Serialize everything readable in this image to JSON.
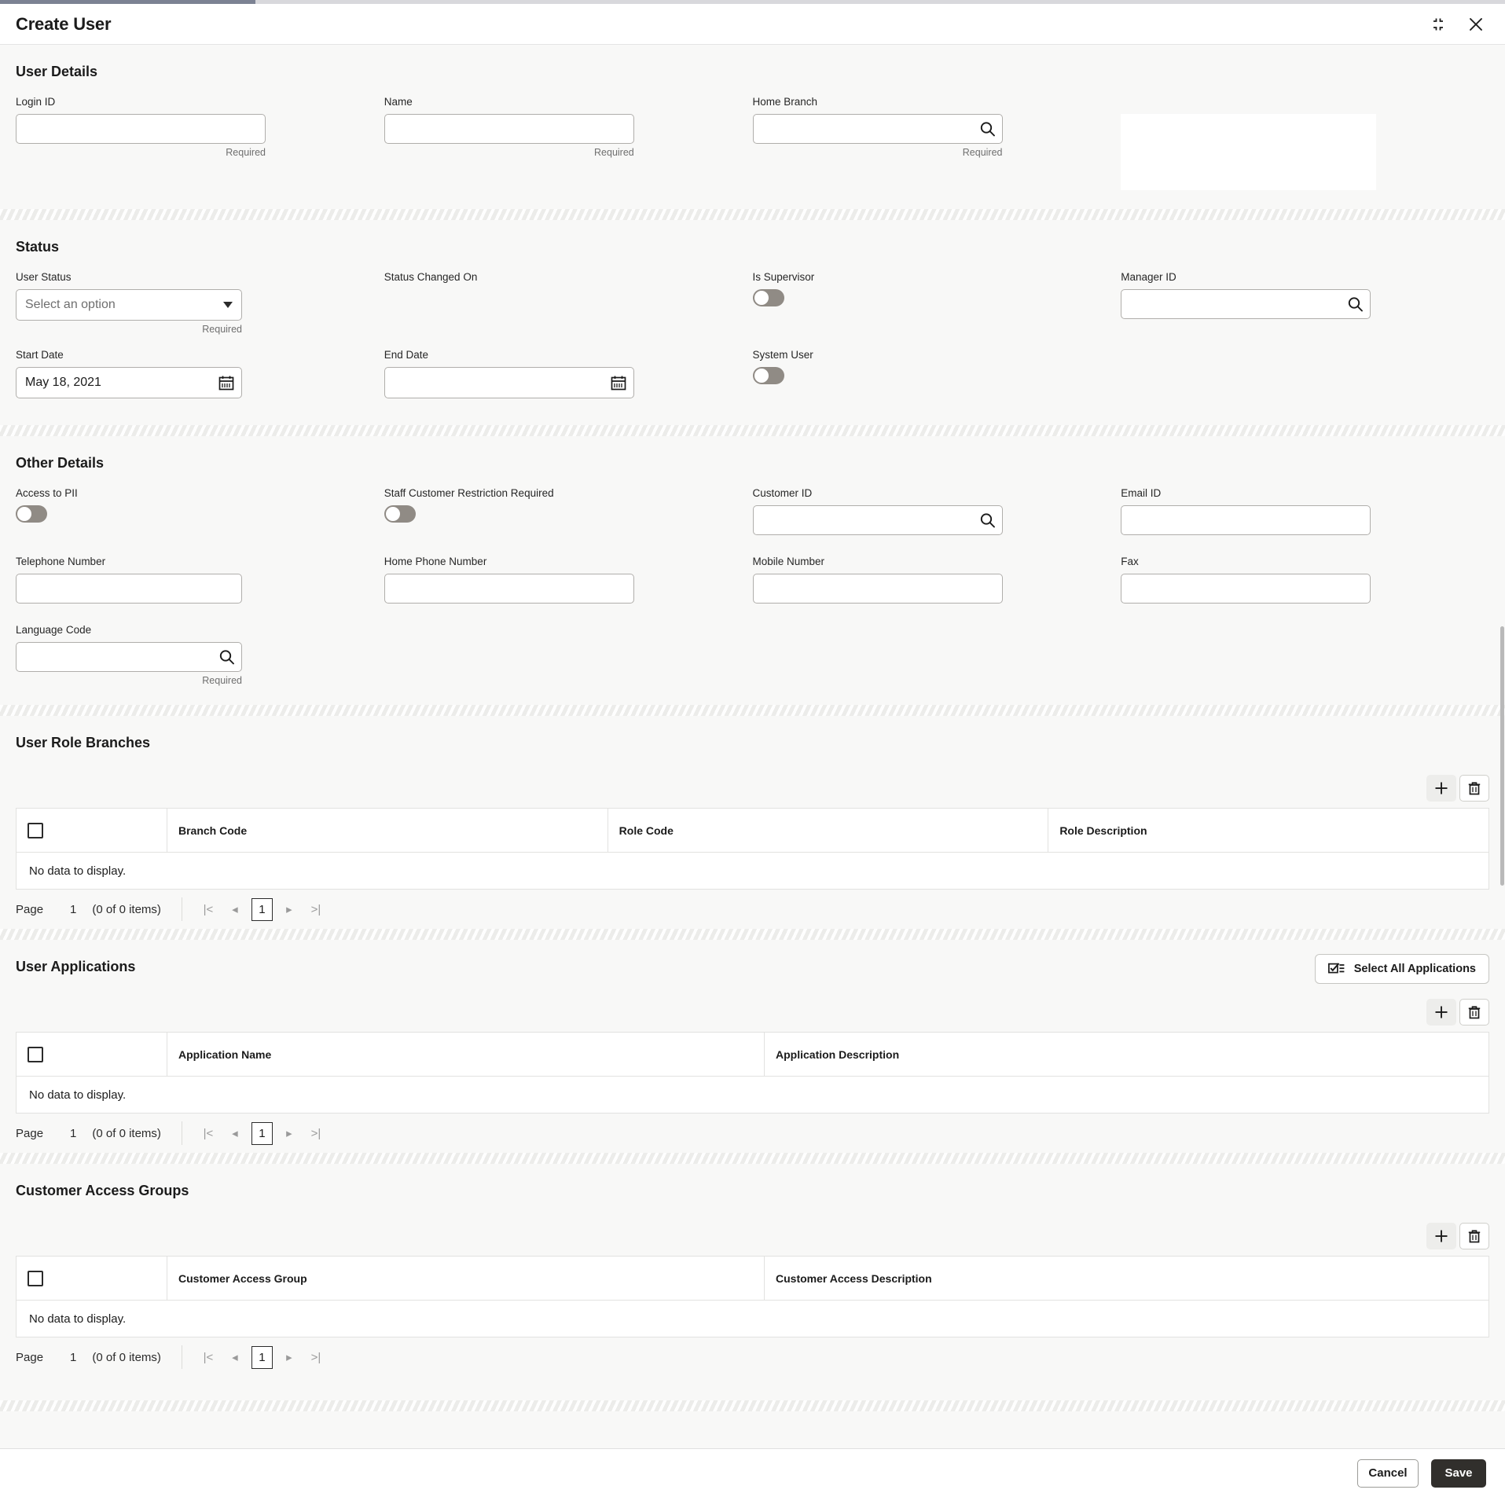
{
  "window": {
    "title": "Create User",
    "collapse_icon": "collapse-expand-icon",
    "close_icon": "close-icon"
  },
  "colors": {
    "page_bg": "#f8f8f7",
    "panel_bg": "#ffffff",
    "border": "#b0aeab",
    "save_bg": "#312f2c",
    "toggle_off": "#908b85",
    "progress_fill": "#7c8293"
  },
  "sections": {
    "user_details": {
      "title": "User Details",
      "fields": [
        {
          "label": "Login ID",
          "value": "",
          "placeholder": "",
          "helper": "Required",
          "type": "text"
        },
        {
          "label": "Name",
          "value": "",
          "placeholder": "",
          "helper": "Required",
          "type": "text"
        },
        {
          "label": "Home Branch",
          "value": "",
          "placeholder": "",
          "helper": "Required",
          "type": "lookup"
        }
      ],
      "photo_placeholder": ""
    },
    "status": {
      "title": "Status",
      "user_status": {
        "label": "User Status",
        "value": "Select an option",
        "helper": "Required"
      },
      "status_changed_on": {
        "label": "Status Changed On",
        "value": ""
      },
      "is_supervisor": {
        "label": "Is Supervisor",
        "state": "off"
      },
      "manager_id": {
        "label": "Manager ID",
        "value": ""
      },
      "start_date": {
        "label": "Start Date",
        "value": "May 18, 2021"
      },
      "end_date": {
        "label": "End Date",
        "value": ""
      },
      "system_user": {
        "label": "System User",
        "state": "off"
      }
    },
    "other_details": {
      "title": "Other Details",
      "access_to_pii": {
        "label": "Access to PII",
        "state": "off"
      },
      "staff_customer_restriction": {
        "label": "Staff Customer Restriction Required",
        "state": "off"
      },
      "customer_id": {
        "label": "Customer ID",
        "value": ""
      },
      "email_id": {
        "label": "Email ID",
        "value": ""
      },
      "telephone_number": {
        "label": "Telephone Number",
        "value": ""
      },
      "home_phone_number": {
        "label": "Home Phone Number",
        "value": ""
      },
      "mobile_number": {
        "label": "Mobile Number",
        "value": ""
      },
      "fax": {
        "label": "Fax",
        "value": ""
      },
      "language_code": {
        "label": "Language Code",
        "value": "",
        "helper": "Required"
      }
    },
    "user_role_branches": {
      "title": "User Role Branches",
      "add_icon": "plus-icon",
      "delete_icon": "trash-icon",
      "columns": [
        "",
        "Branch Code",
        "Role Code",
        "Role Description"
      ],
      "rows": [],
      "empty_text": "No data to display.",
      "pagination": {
        "page_label": "Page",
        "page_number": "1",
        "items_text": "(0 of 0 items)",
        "current_page": "1",
        "first_icon": "|<",
        "prev_icon": "◂",
        "next_icon": "▸",
        "last_icon": ">|"
      }
    },
    "user_applications": {
      "title": "User Applications",
      "select_all_label": "Select All Applications",
      "select_all_icon": "checklist-icon",
      "add_icon": "plus-icon",
      "delete_icon": "trash-icon",
      "columns": [
        "",
        "Application Name",
        "Application Description"
      ],
      "rows": [],
      "empty_text": "No data to display.",
      "pagination": {
        "page_label": "Page",
        "page_number": "1",
        "items_text": "(0 of 0 items)",
        "current_page": "1",
        "first_icon": "|<",
        "prev_icon": "◂",
        "next_icon": "▸",
        "last_icon": ">|"
      }
    },
    "customer_access_groups": {
      "title": "Customer Access Groups",
      "add_icon": "plus-icon",
      "delete_icon": "trash-icon",
      "columns": [
        "",
        "Customer Access Group",
        "Customer Access Description"
      ],
      "rows": [],
      "empty_text": "No data to display.",
      "pagination": {
        "page_label": "Page",
        "page_number": "1",
        "items_text": "(0 of 0 items)",
        "current_page": "1",
        "first_icon": "|<",
        "prev_icon": "◂",
        "next_icon": "▸",
        "last_icon": ">|"
      }
    }
  },
  "footer": {
    "cancel_label": "Cancel",
    "save_label": "Save"
  }
}
